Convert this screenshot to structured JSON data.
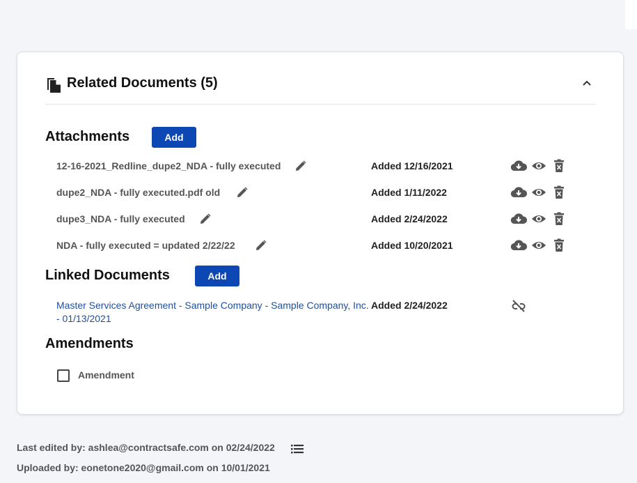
{
  "related_documents": {
    "title": "Related Documents (5)",
    "icon": "document-copy-icon"
  },
  "attachments": {
    "heading": "Attachments",
    "add_label": "Add",
    "items": [
      {
        "name": "12-16-2021_Redline_dupe2_NDA - fully executed",
        "added": "Added 12/16/2021"
      },
      {
        "name": "dupe2_NDA - fully executed.pdf old",
        "added": "Added 1/11/2022"
      },
      {
        "name": "dupe3_NDA - fully executed",
        "added": "Added 2/24/2022"
      },
      {
        "name": "NDA - fully executed = updated 2/22/22",
        "added": "Added 10/20/2021"
      }
    ]
  },
  "linked_documents": {
    "heading": "Linked Documents",
    "add_label": "Add",
    "items": [
      {
        "name": "Master Services Agreement - Sample Company - Sample Company, Inc. - 01/13/2021",
        "added": "Added 2/24/2022"
      }
    ]
  },
  "amendments": {
    "heading": "Amendments",
    "checkbox_label": "Amendment",
    "checked": false
  },
  "footer": {
    "last_edited": "Last edited by: ashlea@contractsafe.com on 02/24/2022",
    "uploaded": "Uploaded by: eonetone2020@gmail.com on 10/01/2021"
  },
  "colors": {
    "accent": "#0d47b4",
    "link": "#1f4f9c",
    "icon": "#555555"
  }
}
